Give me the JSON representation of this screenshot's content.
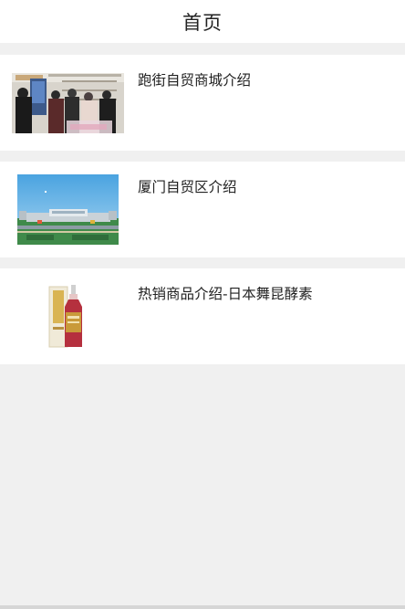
{
  "header": {
    "title": "首页"
  },
  "items": [
    {
      "title": "跑街自贸商城介绍",
      "image": "store-photo"
    },
    {
      "title": "厦门自贸区介绍",
      "image": "free-trade-zone-photo"
    },
    {
      "title": "热销商品介绍-日本舞昆酵素",
      "image": "enzyme-bottle-product-photo"
    }
  ],
  "colors": {
    "background": "#f0f0f0",
    "card": "#ffffff",
    "text": "#222222"
  }
}
